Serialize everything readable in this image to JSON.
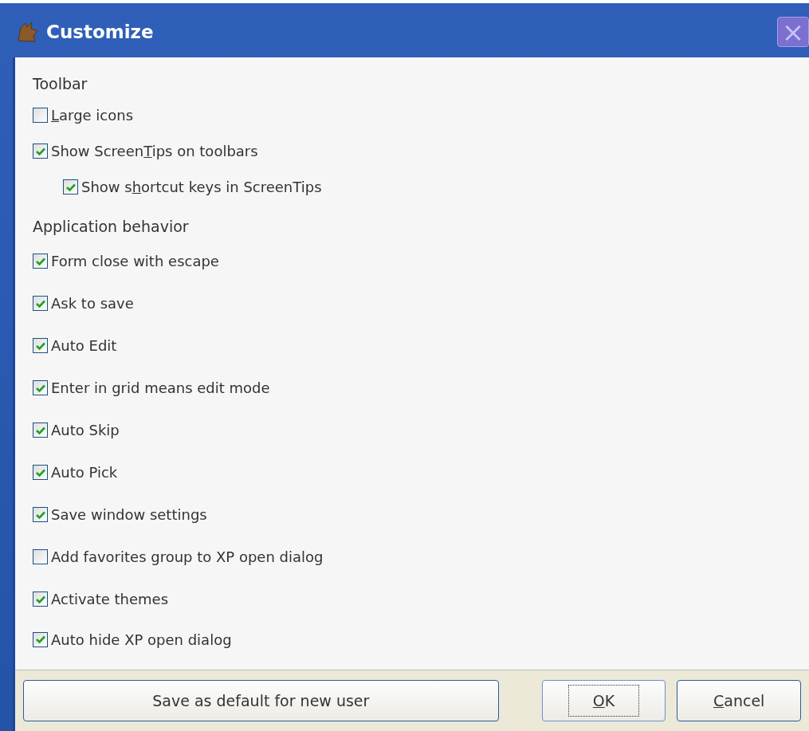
{
  "window": {
    "title": "Customize",
    "close": "×"
  },
  "sections": [
    {
      "heading": "Toolbar",
      "options": [
        {
          "key": "L",
          "post": "arge icons",
          "checked": false,
          "indented": false
        },
        {
          "pre": "Show Screen",
          "key": "T",
          "post": "ips on toolbars",
          "checked": true,
          "indented": false
        },
        {
          "pre": "Show s",
          "key": "h",
          "post": "ortcut keys in ScreenTips",
          "checked": true,
          "indented": true
        }
      ]
    },
    {
      "heading": "Application behavior",
      "options": [
        {
          "pre": "Form close with escape",
          "checked": true,
          "indented": false
        },
        {
          "pre": "Ask to save",
          "checked": true,
          "indented": false
        },
        {
          "pre": "Auto Edit",
          "checked": true,
          "indented": false
        },
        {
          "pre": "Enter in grid means edit mode",
          "checked": true,
          "indented": false
        },
        {
          "pre": "Auto Skip",
          "checked": true,
          "indented": false
        },
        {
          "pre": "Auto Pick",
          "checked": true,
          "indented": false
        },
        {
          "pre": "Save window settings",
          "checked": true,
          "indented": false
        },
        {
          "pre": "Add favorites group to XP open dialog",
          "checked": false,
          "indented": false
        },
        {
          "pre": "Activate themes",
          "checked": true,
          "indented": false
        },
        {
          "pre": "Auto hide XP open dialog",
          "checked": true,
          "indented": false
        }
      ]
    }
  ],
  "buttons": [
    {
      "pre": "Save as default for new user",
      "kind": "wide",
      "focused": false
    },
    {
      "key": "O",
      "post": "K",
      "kind": "normal",
      "focused": true
    },
    {
      "key": "C",
      "post": "ancel",
      "kind": "normal",
      "focused": false
    }
  ]
}
